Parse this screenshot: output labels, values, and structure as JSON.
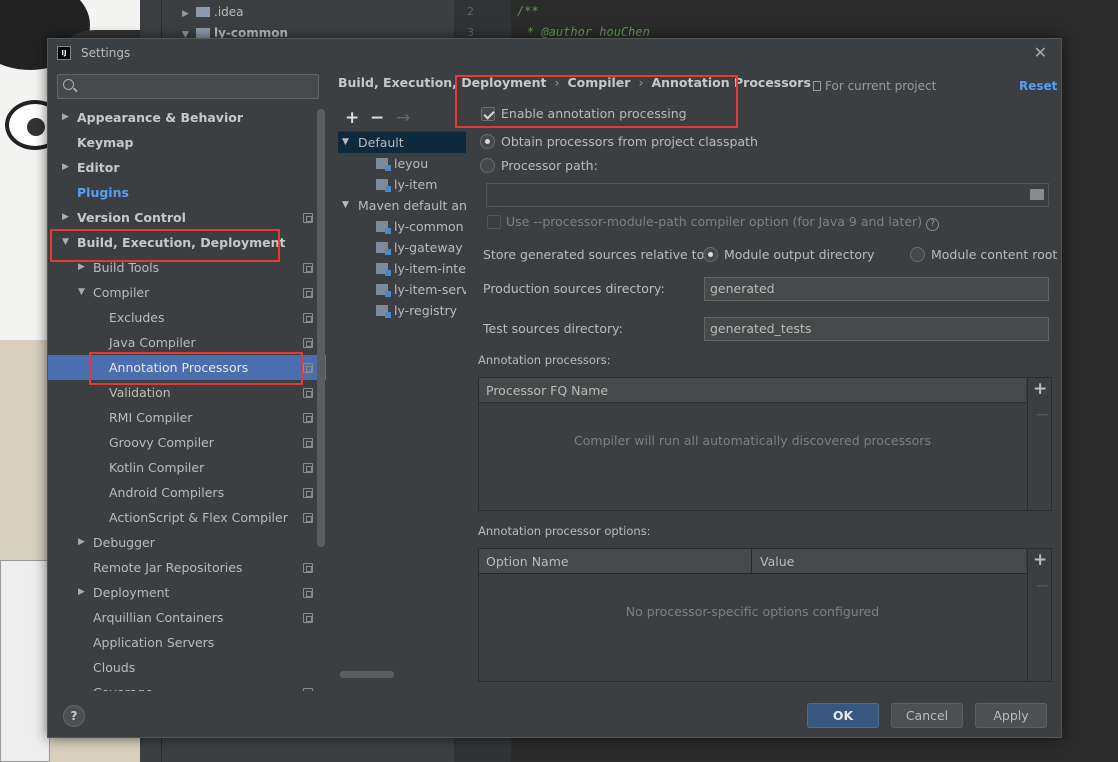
{
  "background": {
    "project_tree": [
      {
        "label": ".idea",
        "expanded": false
      },
      {
        "label": "ly-common",
        "expanded": true
      }
    ],
    "editor": {
      "line_numbers": [
        "2",
        "3"
      ],
      "code_lines": [
        "/**",
        "* @author houChen"
      ]
    }
  },
  "dialog": {
    "title": "Settings",
    "search": {
      "placeholder": "",
      "value": ""
    },
    "nav": [
      {
        "label": "Appearance & Behavior",
        "level": 0,
        "arrow": "right",
        "style": "bold"
      },
      {
        "label": "Keymap",
        "level": 0,
        "arrow": "none",
        "style": "bold"
      },
      {
        "label": "Editor",
        "level": 0,
        "arrow": "right",
        "style": "bold"
      },
      {
        "label": "Plugins",
        "level": 0,
        "arrow": "none",
        "style": "blue"
      },
      {
        "label": "Version Control",
        "level": 0,
        "arrow": "right",
        "style": "bold",
        "config": true
      },
      {
        "label": "Build, Execution, Deployment",
        "level": 0,
        "arrow": "down",
        "style": "bold"
      },
      {
        "label": "Build Tools",
        "level": 1,
        "arrow": "right",
        "config": true
      },
      {
        "label": "Compiler",
        "level": 1,
        "arrow": "down",
        "config": true
      },
      {
        "label": "Excludes",
        "level": 2,
        "config": true
      },
      {
        "label": "Java Compiler",
        "level": 2,
        "config": true
      },
      {
        "label": "Annotation Processors",
        "level": 2,
        "config": true,
        "selected": true
      },
      {
        "label": "Validation",
        "level": 2,
        "config": true
      },
      {
        "label": "RMI Compiler",
        "level": 2,
        "config": true
      },
      {
        "label": "Groovy Compiler",
        "level": 2,
        "config": true
      },
      {
        "label": "Kotlin Compiler",
        "level": 2,
        "config": true
      },
      {
        "label": "Android Compilers",
        "level": 2,
        "config": true
      },
      {
        "label": "ActionScript & Flex Compiler",
        "level": 2,
        "config": true
      },
      {
        "label": "Debugger",
        "level": 1,
        "arrow": "right"
      },
      {
        "label": "Remote Jar Repositories",
        "level": 1,
        "config": true
      },
      {
        "label": "Deployment",
        "level": 1,
        "arrow": "right",
        "config": true
      },
      {
        "label": "Arquillian Containers",
        "level": 1,
        "config": true
      },
      {
        "label": "Application Servers",
        "level": 1
      },
      {
        "label": "Clouds",
        "level": 1
      },
      {
        "label": "Coverage",
        "level": 1,
        "config": true
      }
    ],
    "breadcrumb": [
      "Build, Execution, Deployment",
      "Compiler",
      "Annotation Processors"
    ],
    "breadcrumb_sep": "›",
    "scope_label": "For current project",
    "reset_label": "Reset",
    "profiles_toolbar": {
      "add": "+",
      "remove": "−",
      "move": "→"
    },
    "profiles": [
      {
        "label": "Default",
        "type": "group",
        "expanded": true,
        "selected": true
      },
      {
        "label": "leyou",
        "type": "module"
      },
      {
        "label": "ly-item",
        "type": "module"
      },
      {
        "label": "Maven default annotation processors profile",
        "type": "group",
        "expanded": true
      },
      {
        "label": "ly-common",
        "type": "module"
      },
      {
        "label": "ly-gateway",
        "type": "module"
      },
      {
        "label": "ly-item-interface",
        "type": "module"
      },
      {
        "label": "ly-item-service",
        "type": "module"
      },
      {
        "label": "ly-registry",
        "type": "module"
      }
    ],
    "form": {
      "enable_label": "Enable annotation processing",
      "enable_checked": true,
      "obtain_label": "Obtain processors from project classpath",
      "processor_path_label": "Processor path:",
      "processor_path_value": "",
      "module_path_label": "Use --processor-module-path compiler option (for Java 9 and later)",
      "store_label": "Store generated sources relative to:",
      "module_output_label": "Module output directory",
      "module_content_label": "Module content root",
      "prod_label": "Production sources directory:",
      "prod_value": "generated",
      "test_label": "Test sources directory:",
      "test_value": "generated_tests",
      "processors_section": "Annotation processors:",
      "processors_header": "Processor FQ Name",
      "processors_empty": "Compiler will run all automatically discovered processors",
      "options_section": "Annotation processor options:",
      "options_headers": [
        "Option Name",
        "Value"
      ],
      "options_empty": "No processor-specific options configured",
      "add_symbol": "+",
      "remove_symbol": "−"
    },
    "buttons": {
      "ok": "OK",
      "cancel": "Cancel",
      "apply": "Apply",
      "help": "?"
    }
  }
}
